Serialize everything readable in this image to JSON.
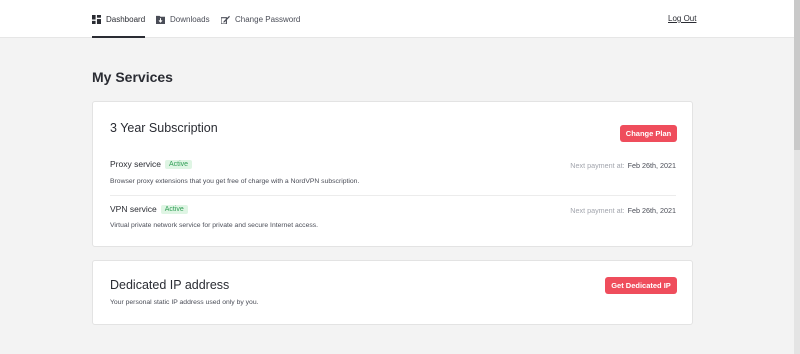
{
  "nav": {
    "items": [
      {
        "label": "Dashboard",
        "icon": "dashboard-icon",
        "active": true
      },
      {
        "label": "Downloads",
        "icon": "download-icon",
        "active": false
      },
      {
        "label": "Change Password",
        "icon": "edit-icon",
        "active": false
      }
    ],
    "logout": "Log Out"
  },
  "page": {
    "title": "My Services"
  },
  "subscription": {
    "title": "3 Year Subscription",
    "button": "Change Plan",
    "services": [
      {
        "name": "Proxy service",
        "status": "Active",
        "description": "Browser proxy extensions that you get free of charge with a NordVPN subscription.",
        "next_label": "Next payment at:",
        "next_date": "Feb 26th, 2021"
      },
      {
        "name": "VPN service",
        "status": "Active",
        "description": "Virtual private network service for private and secure Internet access.",
        "next_label": "Next payment at:",
        "next_date": "Feb 26th, 2021"
      }
    ]
  },
  "dedicated_ip": {
    "title": "Dedicated IP address",
    "description": "Your personal static IP address used only by you.",
    "button": "Get Dedicated IP"
  },
  "colors": {
    "accent": "#ef4d5c",
    "badge_bg": "#dff5e4",
    "badge_text": "#2f9e55",
    "page_bg": "#f3f3f3"
  }
}
